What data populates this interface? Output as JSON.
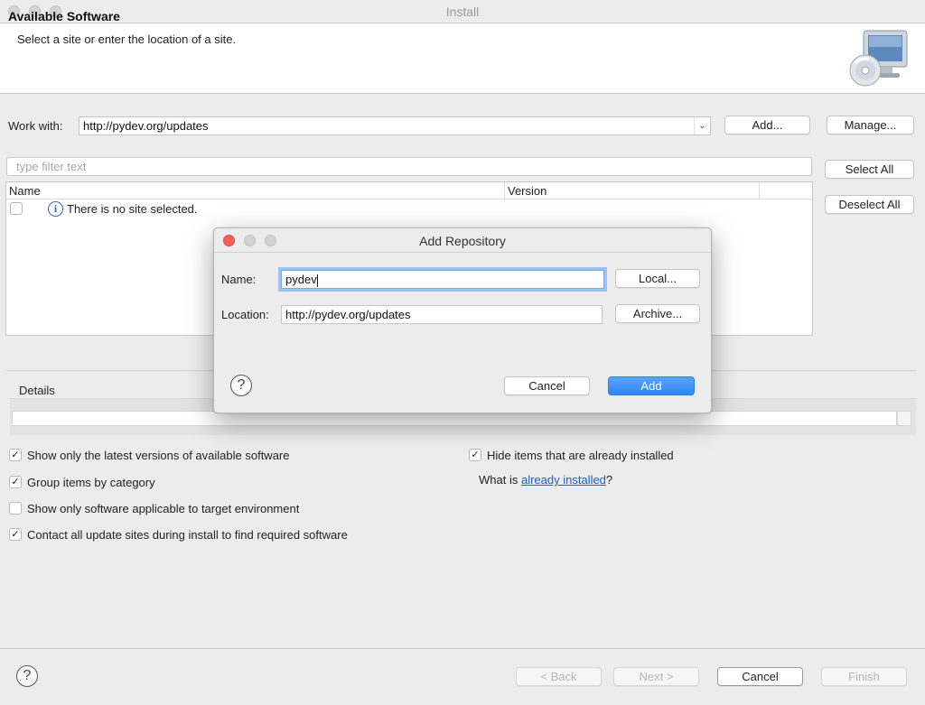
{
  "window": {
    "title": "Install"
  },
  "header": {
    "title": "Available Software",
    "subtitle": "Select a site or enter the location of a site."
  },
  "work_with": {
    "label": "Work with:",
    "value": "http://pydev.org/updates",
    "add_label": "Add...",
    "manage_label": "Manage..."
  },
  "filter": {
    "placeholder": "type filter text"
  },
  "side_buttons": {
    "select_all": "Select All",
    "deselect_all": "Deselect All"
  },
  "table": {
    "columns": [
      "Name",
      "Version"
    ],
    "rows": [
      {
        "text": "There is no site selected.",
        "checked": false
      }
    ]
  },
  "details": {
    "label": "Details"
  },
  "options": {
    "left": [
      {
        "label": "Show only the latest versions of available software",
        "checked": true
      },
      {
        "label": "Group items by category",
        "checked": true
      },
      {
        "label": "Show only software applicable to target environment",
        "checked": false
      },
      {
        "label": "Contact all update sites during install to find required software",
        "checked": true
      }
    ],
    "hide_installed": {
      "label": "Hide items that are already installed",
      "checked": true
    },
    "what_is_prefix": "What is ",
    "what_is_link": "already installed",
    "what_is_suffix": "?"
  },
  "dialog": {
    "title": "Add Repository",
    "name_label": "Name:",
    "name_value": "pydev",
    "location_label": "Location:",
    "location_value": "http://pydev.org/updates",
    "local_label": "Local...",
    "archive_label": "Archive...",
    "cancel_label": "Cancel",
    "add_label": "Add",
    "help_glyph": "?"
  },
  "footer": {
    "help_glyph": "?",
    "back_label": "< Back",
    "next_label": "Next >",
    "cancel_label": "Cancel",
    "finish_label": "Finish"
  },
  "colors": {
    "primary": "#2f86f6",
    "link": "#1a5fd0",
    "close_light": "#fc5f57"
  },
  "icons": {
    "info": "info-icon",
    "install_banner": "cd-monitor-icon",
    "help": "question-mark-icon"
  }
}
